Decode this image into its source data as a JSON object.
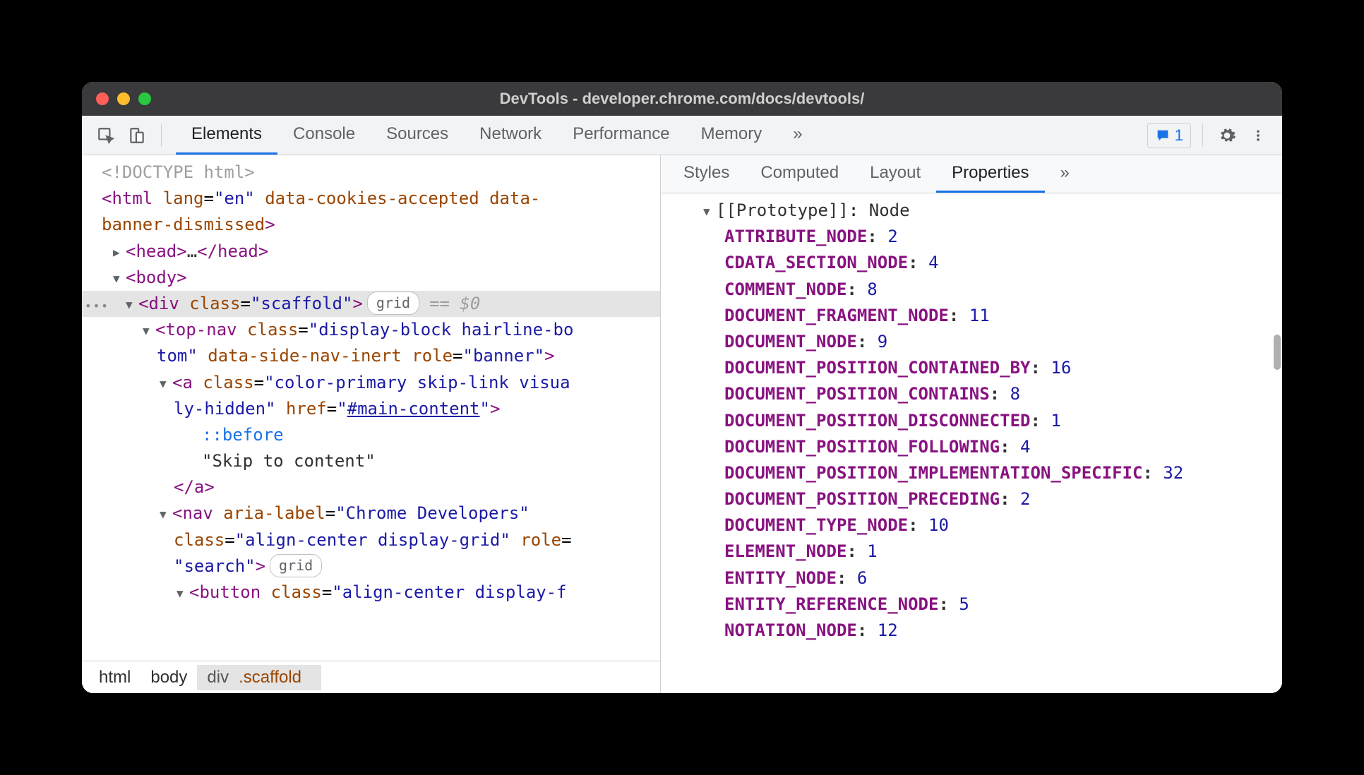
{
  "window": {
    "title": "DevTools - developer.chrome.com/docs/devtools/"
  },
  "toolbar": {
    "tabs": [
      "Elements",
      "Console",
      "Sources",
      "Network",
      "Performance",
      "Memory"
    ],
    "active_tab": 0,
    "more_glyph": "»",
    "issues_count": "1"
  },
  "dom": {
    "doctype": "<!DOCTYPE html>",
    "html_open": {
      "tag": "html",
      "attrs": "lang=\"en\" data-cookies-accepted data-banner-dismissed"
    },
    "head": {
      "tag": "head",
      "ellipsis": "…"
    },
    "body": {
      "tag": "body"
    },
    "scaffold": {
      "tag": "div",
      "class": "scaffold",
      "pill": "grid",
      "eq": "== $0"
    },
    "topnav": {
      "tag": "top-nav",
      "class_part1": "display-block hairline-bo",
      "line2": "tom\" data-side-nav-inert role=\"banner\">"
    },
    "a": {
      "tag": "a",
      "class_part1": "color-primary skip-link visua",
      "line2": "ly-hidden\" href=\"",
      "href": "#main-content",
      "line2_end": "\">"
    },
    "before": "::before",
    "skip_text": "\"Skip to content\"",
    "a_close": "</a>",
    "nav": {
      "tag": "nav",
      "aria": "Chrome Developers",
      "line2": "class=\"align-center display-grid\" role=",
      "line3": "\"search\">",
      "pill": "grid"
    },
    "button": {
      "tag": "button",
      "class_part": "align-center display-f"
    }
  },
  "breadcrumb": [
    "html",
    "body",
    "div.scaffold"
  ],
  "side_tabs": [
    "Styles",
    "Computed",
    "Layout",
    "Properties"
  ],
  "side_active": 3,
  "side_more": "»",
  "proto": {
    "label": "[[Prototype]]",
    "value": "Node"
  },
  "properties": [
    {
      "key": "ATTRIBUTE_NODE",
      "value": "2"
    },
    {
      "key": "CDATA_SECTION_NODE",
      "value": "4"
    },
    {
      "key": "COMMENT_NODE",
      "value": "8"
    },
    {
      "key": "DOCUMENT_FRAGMENT_NODE",
      "value": "11"
    },
    {
      "key": "DOCUMENT_NODE",
      "value": "9"
    },
    {
      "key": "DOCUMENT_POSITION_CONTAINED_BY",
      "value": "16"
    },
    {
      "key": "DOCUMENT_POSITION_CONTAINS",
      "value": "8"
    },
    {
      "key": "DOCUMENT_POSITION_DISCONNECTED",
      "value": "1"
    },
    {
      "key": "DOCUMENT_POSITION_FOLLOWING",
      "value": "4"
    },
    {
      "key": "DOCUMENT_POSITION_IMPLEMENTATION_SPECIFIC",
      "value": "32"
    },
    {
      "key": "DOCUMENT_POSITION_PRECEDING",
      "value": "2"
    },
    {
      "key": "DOCUMENT_TYPE_NODE",
      "value": "10"
    },
    {
      "key": "ELEMENT_NODE",
      "value": "1"
    },
    {
      "key": "ENTITY_NODE",
      "value": "6"
    },
    {
      "key": "ENTITY_REFERENCE_NODE",
      "value": "5"
    },
    {
      "key": "NOTATION_NODE",
      "value": "12"
    }
  ]
}
